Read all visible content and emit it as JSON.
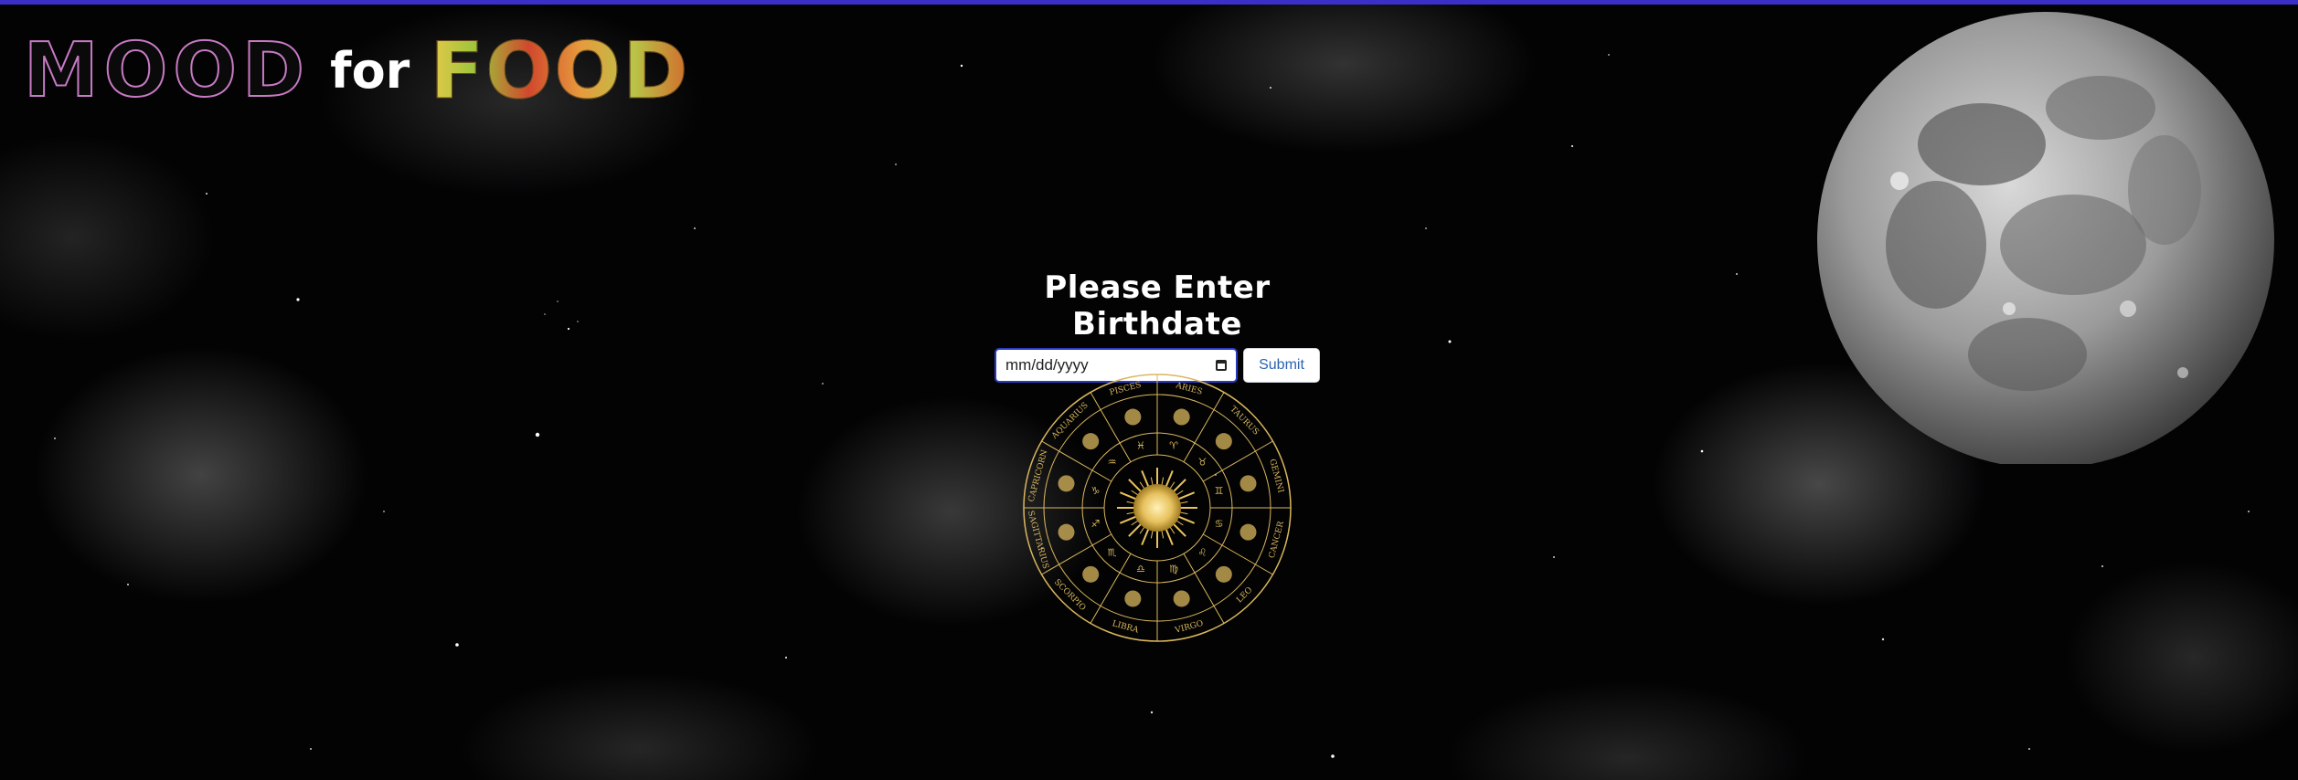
{
  "logo": {
    "mood": "MOOD",
    "for": "for",
    "food": "FOOD"
  },
  "form": {
    "title": "Please Enter Birthdate",
    "date_placeholder": "mm/dd/yyyy",
    "submit_label": "Submit"
  },
  "zodiac": {
    "signs": [
      "PISCES",
      "ARIES",
      "TAURUS",
      "GEMINI",
      "CANCER",
      "LEO",
      "VIRGO",
      "LIBRA",
      "SCORPIO",
      "SAGITTARIUS",
      "CAPRICORN",
      "AQUARIUS"
    ],
    "symbols": [
      "♓",
      "♈",
      "♉",
      "♊",
      "♋",
      "♌",
      "♍",
      "♎",
      "♏",
      "♐",
      "♑",
      "♒"
    ]
  },
  "colors": {
    "accent_bar": "#3a2fc9",
    "zodiac_gold": "#d9b75c",
    "input_border": "#2a3bbf",
    "submit_text": "#2c63b0"
  }
}
